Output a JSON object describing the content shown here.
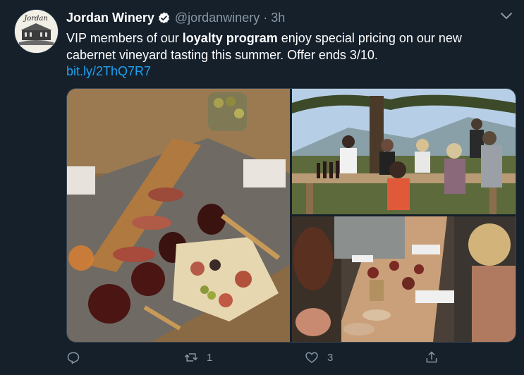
{
  "author": {
    "name": "Jordan Winery",
    "handle": "@jordanwinery",
    "separator": "·",
    "time": "3h",
    "avatar_text": "Jordan"
  },
  "tweet": {
    "text_before": "VIP members of our ",
    "text_bold": "loyalty program",
    "text_after": " enjoy special pricing on our new cabernet vineyard tasting this summer. Offer ends 3/10.",
    "link": "bit.ly/2ThQ7R7"
  },
  "media": {
    "photos": [
      "charcuterie-board-wine-glasses-photo",
      "outdoor-vineyard-tasting-photo",
      "long-table-tasting-photo"
    ]
  },
  "actions": {
    "reply_count": "",
    "retweet_count": "1",
    "like_count": "3"
  },
  "colors": {
    "background": "#15202b",
    "link": "#1da1f2",
    "muted": "#8899a6",
    "verified": "#ffffff"
  }
}
